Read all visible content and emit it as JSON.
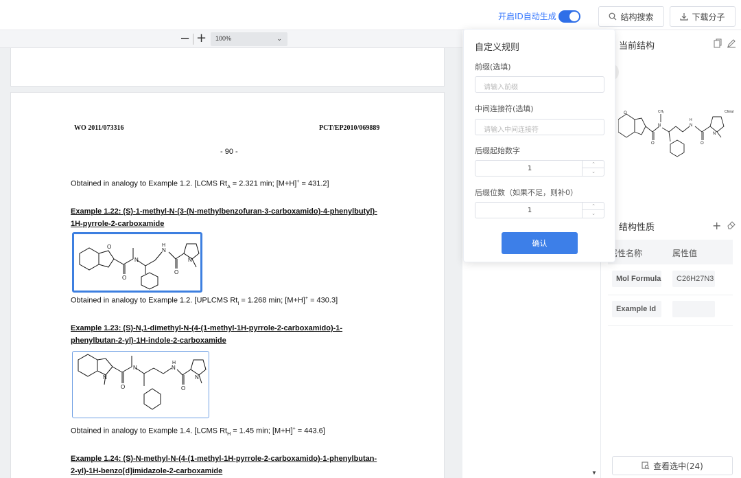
{
  "topbar": {
    "auto_id_label": "开启ID自动生成",
    "auto_id_enabled": true,
    "search_btn": "结构搜索",
    "download_btn": "下载分子"
  },
  "viewer": {
    "zoom_minus": "−",
    "zoom_plus": "+",
    "zoom_value": "100%",
    "page": {
      "header_left": "WO 2011/073316",
      "header_right": "PCT/EP2010/069889",
      "page_number": "- 90 -",
      "line1": "Obtained in analogy to Example 1.2. [LCMS Rt",
      "line1_sub": "A",
      "line1_rest": " = 2.321 min; [M+H]",
      "line1_sup": "+",
      "line1_end": " = 431.2]",
      "ex122_title_a": "Example 1.22: (S)-1-methyl-N-(3-(N-methylbenzofuran-3-carboxamido)-4-phenylbutyl)-",
      "ex122_title_b": "1H-pyrrole-2-carboxamide",
      "line2": "Obtained in analogy to Example 1.2. [UPLCMS Rt",
      "line2_sub": "I",
      "line2_rest": " = 1.268 min; [M+H]",
      "line2_sup": "+",
      "line2_end": " = 430.3]",
      "ex123_title_a": "Example 1.23: (S)-N,1-dimethyl-N-(4-(1-methyl-1H-pyrrole-2-carboxamido)-1-",
      "ex123_title_b": "phenylbutan-2-yl)-1H-indole-2-carboxamide",
      "line3": "Obtained in analogy to Example 1.4. [LCMS Rt",
      "line3_sub": "H",
      "line3_rest": " = 1.45 min; [M+H]",
      "line3_sup": "+",
      "line3_end": " = 443.6]",
      "ex124_title_a": "Example 1.24: (S)-N-methyl-N-(4-(1-methyl-1H-pyrrole-2-carboxamido)-1-phenylbutan-",
      "ex124_title_b": "2-yl)-1H-benzo[d]imidazole-2-carboxamide"
    }
  },
  "popover": {
    "title": "自定义规则",
    "prefix_label": "前缀(选填)",
    "prefix_placeholder": "请输入前缀",
    "connector_label": "中间连接符(选填)",
    "connector_placeholder": "请输入中间连接符",
    "suffix_start_label": "后缀起始数字",
    "suffix_start_value": "1",
    "suffix_digits_label": "后缀位数（如果不足，则补0）",
    "suffix_digits_value": "1",
    "confirm": "确认"
  },
  "right_panel": {
    "current_title": "当前结构",
    "props_title": "结构性质",
    "col_name": "属性名称",
    "col_value": "属性值",
    "rows": [
      {
        "name": "Mol Formula",
        "value": "C26H27N3"
      },
      {
        "name": "Example Id",
        "value": ""
      }
    ],
    "view_selected": "查看选中(24)",
    "chiral_label": "Chiral",
    "ch3_label": "CH₃"
  },
  "icons": {
    "search": "search-icon",
    "download": "download-icon",
    "copy": "copy-icon",
    "edit": "edit-icon",
    "add": "plus-icon",
    "eraser": "eraser-icon",
    "view": "view-selected-icon"
  },
  "colors": {
    "accent": "#3d7fe8",
    "toggle": "#2f6fe8",
    "link_text": "#3a7afe"
  }
}
